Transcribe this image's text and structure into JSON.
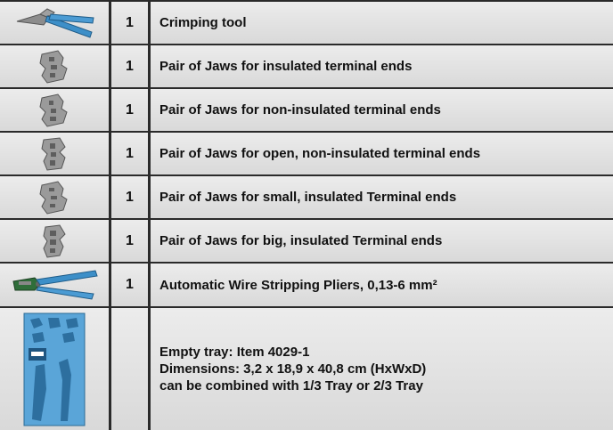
{
  "items": [
    {
      "icon": "crimping-tool-icon",
      "qty": "1",
      "desc": "Crimping tool"
    },
    {
      "icon": "jaws-icon",
      "qty": "1",
      "desc": "Pair of Jaws for insulated terminal ends"
    },
    {
      "icon": "jaws-icon",
      "qty": "1",
      "desc": "Pair of Jaws for non-insulated terminal ends"
    },
    {
      "icon": "jaws-icon",
      "qty": "1",
      "desc": "Pair of Jaws for open, non-insulated terminal ends"
    },
    {
      "icon": "jaws-icon",
      "qty": "1",
      "desc": "Pair of Jaws for small, insulated Terminal ends"
    },
    {
      "icon": "jaws-icon",
      "qty": "1",
      "desc": "Pair of Jaws for big, insulated Terminal ends"
    },
    {
      "icon": "wire-stripping-pliers-icon",
      "qty": "1",
      "desc": "Automatic Wire Stripping Pliers, 0,13-6 mm²"
    }
  ],
  "tray": {
    "icon": "foam-tray-icon",
    "qty": "",
    "lines": [
      "Empty tray: Item 4029-1",
      "Dimensions: 3,2 x 18,9 x 40,8 cm (HxWxD)",
      "can be combined with 1/3 Tray or 2/3 Tray"
    ]
  },
  "colors": {
    "tray_blue": "#5aa5d8",
    "tool_blue": "#3d8fc8",
    "metal": "#9a9a9a"
  }
}
